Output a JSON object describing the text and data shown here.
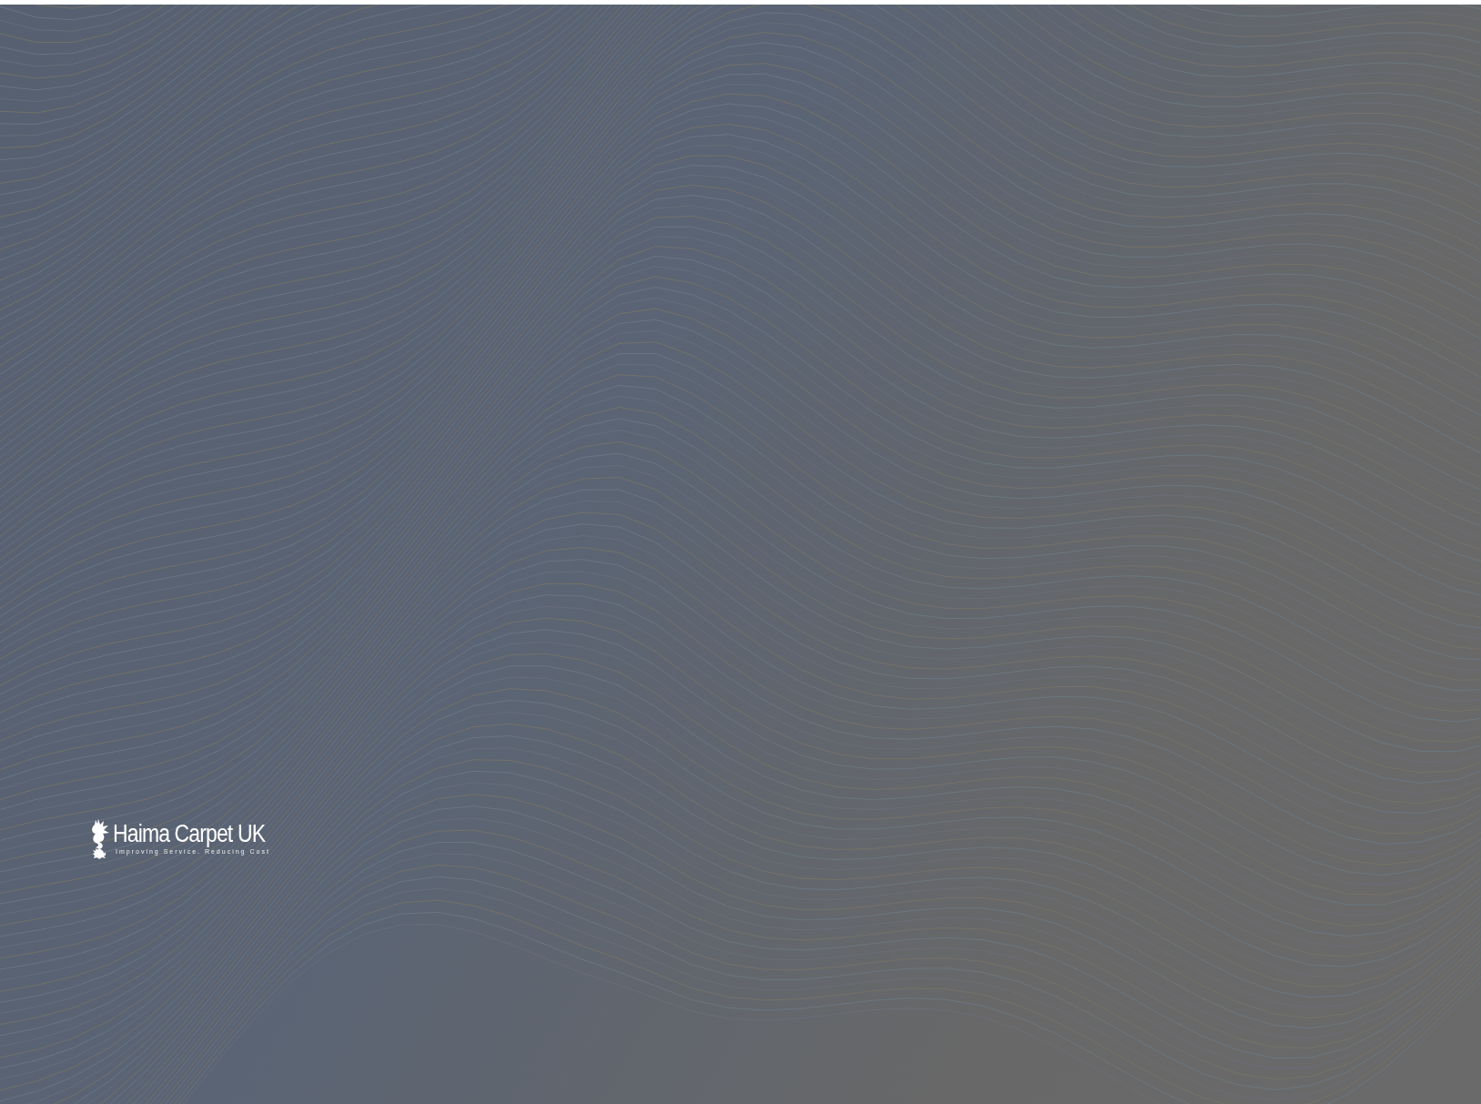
{
  "logo": {
    "name": "Haima Carpet UK",
    "tagline": "Improving Service. Reducing Cost"
  }
}
